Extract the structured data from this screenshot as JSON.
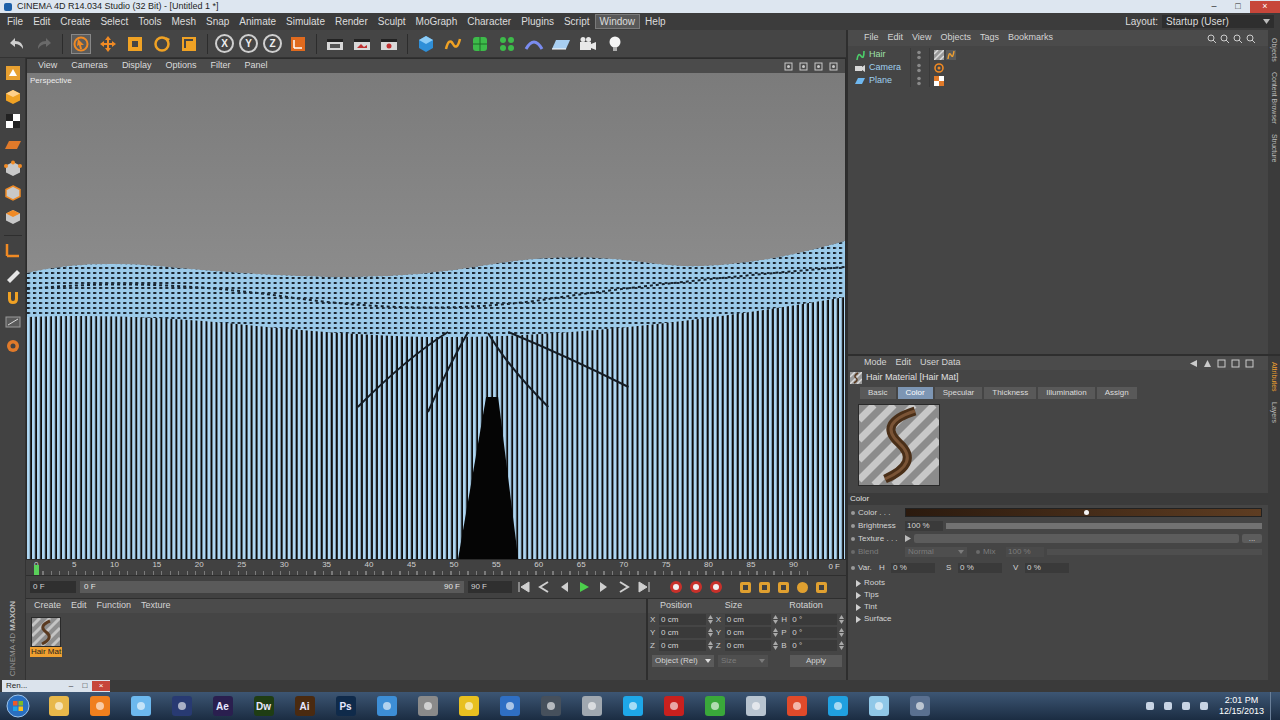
{
  "window": {
    "title": "CINEMA 4D R14.034 Studio (32 Bit) - [Untitled 1 *]",
    "controls": [
      "–",
      "□",
      "×"
    ]
  },
  "menubar": {
    "items": [
      {
        "label": "File",
        "selected": false
      },
      {
        "label": "Edit",
        "selected": false
      },
      {
        "label": "Create",
        "selected": false
      },
      {
        "label": "Select",
        "selected": false
      },
      {
        "label": "Tools",
        "selected": false
      },
      {
        "label": "Mesh",
        "selected": false
      },
      {
        "label": "Snap",
        "selected": false
      },
      {
        "label": "Animate",
        "selected": false
      },
      {
        "label": "Simulate",
        "selected": false
      },
      {
        "label": "Render",
        "selected": false
      },
      {
        "label": "Sculpt",
        "selected": false
      },
      {
        "label": "MoGraph",
        "selected": false
      },
      {
        "label": "Character",
        "selected": false
      },
      {
        "label": "Plugins",
        "selected": false
      },
      {
        "label": "Script",
        "selected": false
      },
      {
        "label": "Window",
        "selected": true
      },
      {
        "label": "Help",
        "selected": false
      }
    ],
    "layout_label": "Layout:",
    "layout_value": "Startup (User)"
  },
  "toolbar": {
    "axes": [
      "X",
      "Y",
      "Z"
    ]
  },
  "viewport": {
    "menu": [
      "View",
      "Cameras",
      "Display",
      "Options",
      "Filter",
      "Panel"
    ],
    "label": "Perspective"
  },
  "timeline": {
    "ticks": [
      "0",
      "5",
      "10",
      "15",
      "20",
      "25",
      "30",
      "35",
      "40",
      "45",
      "50",
      "55",
      "60",
      "65",
      "70",
      "75",
      "80",
      "85",
      "90"
    ],
    "current": "0 F",
    "start": "0 F",
    "range_start": "0 F",
    "range_end": "90 F",
    "end": "90 F",
    "playhead": 0
  },
  "materials": {
    "menu": [
      "Create",
      "Edit",
      "Function",
      "Texture"
    ],
    "items": [
      {
        "name": "Hair Mat",
        "selected": true
      }
    ]
  },
  "coordinates": {
    "headers": [
      "Position",
      "Size",
      "Rotation"
    ],
    "rows": [
      {
        "p_axis": "X",
        "p": "0 cm",
        "s_axis": "X",
        "s": "0 cm",
        "r_axis": "H",
        "r": "0 °"
      },
      {
        "p_axis": "Y",
        "p": "0 cm",
        "s_axis": "Y",
        "s": "0 cm",
        "r_axis": "P",
        "r": "0 °"
      },
      {
        "p_axis": "Z",
        "p": "0 cm",
        "s_axis": "Z",
        "s": "0 cm",
        "r_axis": "B",
        "r": "0 °"
      }
    ],
    "mode": "Object (Rel)",
    "size_mode": {
      "label": "Size",
      "disabled": true
    },
    "apply": "Apply"
  },
  "logo": {
    "brand": "MAXON",
    "product": "CINEMA 4D"
  },
  "objects": {
    "menu": [
      "File",
      "Edit",
      "View",
      "Objects",
      "Tags",
      "Bookmarks"
    ],
    "items": [
      {
        "name": "Hair",
        "kind": "hair",
        "tags": [
          "material",
          "hair"
        ]
      },
      {
        "name": "Camera",
        "kind": "camera",
        "tags": [
          "target"
        ]
      },
      {
        "name": "Plane",
        "kind": "plane",
        "tags": [
          "texture"
        ]
      }
    ],
    "side_tabs": [
      "Objects",
      "Content Browser",
      "Structure"
    ]
  },
  "attributes": {
    "menu": [
      "Mode",
      "Edit",
      "User Data"
    ],
    "title": "Hair Material [Hair Mat]",
    "tabs": [
      {
        "label": "Basic",
        "selected": false
      },
      {
        "label": "Color",
        "selected": true
      },
      {
        "label": "Specular",
        "selected": false
      },
      {
        "label": "Thickness",
        "selected": false
      },
      {
        "label": "Illumination",
        "selected": false
      },
      {
        "label": "Assign",
        "selected": false
      }
    ],
    "section": "Color",
    "color": {
      "label": "Color . . .",
      "from": "#2b1a0e",
      "to": "#5e3d22"
    },
    "brightness": {
      "label": "Brightness",
      "value": "100 %",
      "level": 1
    },
    "texture": {
      "label": "Texture . . .",
      "button": "..."
    },
    "blend": {
      "label": "Blend",
      "value": "Normal",
      "mix_label": "Mix",
      "mix_value": "100 %",
      "disabled": true
    },
    "variation": {
      "label": "Var.",
      "fields": [
        {
          "axis": "H",
          "value": "0 %"
        },
        {
          "axis": "S",
          "value": "0 %"
        },
        {
          "axis": "V",
          "value": "0 %"
        }
      ]
    },
    "groups": [
      {
        "label": "Roots",
        "expanded": false
      },
      {
        "label": "Tips",
        "expanded": false
      },
      {
        "label": "Tint",
        "expanded": false
      },
      {
        "label": "Surface",
        "expanded": false
      }
    ],
    "side_tabs": [
      "Attributes",
      "Layers"
    ]
  },
  "status": {
    "task": "Ren...",
    "controls": [
      "–",
      "□",
      "×"
    ]
  },
  "taskbar": {
    "apps": [
      {
        "kind": "tile",
        "color": "#e8b84a"
      },
      {
        "kind": "tile",
        "color": "#f07f1e"
      },
      {
        "kind": "tile",
        "color": "#6cb8ee"
      },
      {
        "kind": "tile",
        "color": "#283a72"
      },
      {
        "kind": "letter",
        "label": "Ae",
        "color": "#2a1f4f"
      },
      {
        "kind": "letter",
        "label": "Dw",
        "color": "#1f3d14"
      },
      {
        "kind": "letter",
        "label": "Ai",
        "color": "#4a2a10"
      },
      {
        "kind": "letter",
        "label": "Ps",
        "color": "#0f2a4a"
      },
      {
        "kind": "tile",
        "color": "#3d8ed6"
      },
      {
        "kind": "tile",
        "color": "#8a8a8a"
      },
      {
        "kind": "tile",
        "color": "#e8c020"
      },
      {
        "kind": "tile",
        "color": "#2f6fc4"
      },
      {
        "kind": "tile",
        "color": "#46505c"
      },
      {
        "kind": "tile",
        "color": "#a0a8b0"
      },
      {
        "kind": "tile",
        "color": "#1ea7e8"
      },
      {
        "kind": "tile",
        "color": "#c8201e"
      },
      {
        "kind": "tile",
        "color": "#3aa83a"
      },
      {
        "kind": "tile",
        "color": "#b8c4d0"
      },
      {
        "kind": "tile",
        "color": "#e04a2a"
      },
      {
        "kind": "tile",
        "color": "#20a0e0"
      },
      {
        "kind": "tile",
        "color": "#90c8e8"
      },
      {
        "kind": "tile",
        "color": "#5a7090"
      }
    ],
    "time": "2:01 PM",
    "date": "12/15/2013"
  }
}
